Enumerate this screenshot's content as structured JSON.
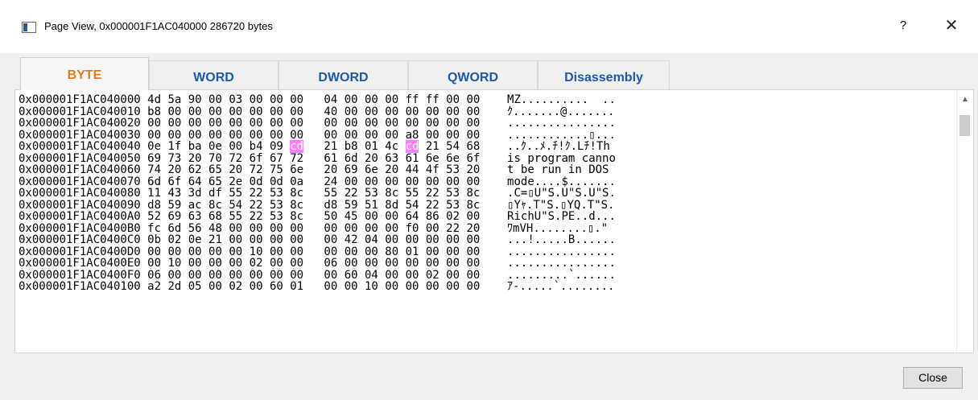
{
  "window": {
    "title": "Page View, 0x000001F1AC040000 286720 bytes",
    "help_label": "?",
    "close_glyph": "✕"
  },
  "tabs": [
    {
      "label": "BYTE",
      "active": true
    },
    {
      "label": "WORD",
      "active": false
    },
    {
      "label": "DWORD",
      "active": false
    },
    {
      "label": "QWORD",
      "active": false
    },
    {
      "label": "Disassembly",
      "active": false
    }
  ],
  "hex_rows": [
    {
      "addr": "0x000001F1AC040000",
      "b1": [
        "4d",
        "5a",
        "90",
        "00",
        "03",
        "00",
        "00",
        "00"
      ],
      "b2": [
        "04",
        "00",
        "00",
        "00",
        "ff",
        "ff",
        "00",
        "00"
      ],
      "ascii": "MZ..........  .."
    },
    {
      "addr": "0x000001F1AC040010",
      "b1": [
        "b8",
        "00",
        "00",
        "00",
        "00",
        "00",
        "00",
        "00"
      ],
      "b2": [
        "40",
        "00",
        "00",
        "00",
        "00",
        "00",
        "00",
        "00"
      ],
      "ascii": "ｸ.......@......."
    },
    {
      "addr": "0x000001F1AC040020",
      "b1": [
        "00",
        "00",
        "00",
        "00",
        "00",
        "00",
        "00",
        "00"
      ],
      "b2": [
        "00",
        "00",
        "00",
        "00",
        "00",
        "00",
        "00",
        "00"
      ],
      "ascii": "................"
    },
    {
      "addr": "0x000001F1AC040030",
      "b1": [
        "00",
        "00",
        "00",
        "00",
        "00",
        "00",
        "00",
        "00"
      ],
      "b2": [
        "00",
        "00",
        "00",
        "00",
        "a8",
        "00",
        "00",
        "00"
      ],
      "ascii": "............▯..."
    },
    {
      "addr": "0x000001F1AC040040",
      "b1": [
        "0e",
        "1f",
        "ba",
        "0e",
        "00",
        "b4",
        "09",
        "cd"
      ],
      "b2": [
        "21",
        "b8",
        "01",
        "4c",
        "cd",
        "21",
        "54",
        "68"
      ],
      "ascii": "..ｸ..ﾒ.ﾁ!ｸ.Lﾁ!Th"
    },
    {
      "addr": "0x000001F1AC040050",
      "b1": [
        "69",
        "73",
        "20",
        "70",
        "72",
        "6f",
        "67",
        "72"
      ],
      "b2": [
        "61",
        "6d",
        "20",
        "63",
        "61",
        "6e",
        "6e",
        "6f"
      ],
      "ascii": "is program canno"
    },
    {
      "addr": "0x000001F1AC040060",
      "b1": [
        "74",
        "20",
        "62",
        "65",
        "20",
        "72",
        "75",
        "6e"
      ],
      "b2": [
        "20",
        "69",
        "6e",
        "20",
        "44",
        "4f",
        "53",
        "20"
      ],
      "ascii": "t be run in DOS "
    },
    {
      "addr": "0x000001F1AC040070",
      "b1": [
        "6d",
        "6f",
        "64",
        "65",
        "2e",
        "0d",
        "0d",
        "0a"
      ],
      "b2": [
        "24",
        "00",
        "00",
        "00",
        "00",
        "00",
        "00",
        "00"
      ],
      "ascii": "mode....$......."
    },
    {
      "addr": "0x000001F1AC040080",
      "b1": [
        "11",
        "43",
        "3d",
        "df",
        "55",
        "22",
        "53",
        "8c"
      ],
      "b2": [
        "55",
        "22",
        "53",
        "8c",
        "55",
        "22",
        "53",
        "8c"
      ],
      "ascii": ".C=▯U\"S.U\"S.U\"S."
    },
    {
      "addr": "0x000001F1AC040090",
      "b1": [
        "d8",
        "59",
        "ac",
        "8c",
        "54",
        "22",
        "53",
        "8c"
      ],
      "b2": [
        "d8",
        "59",
        "51",
        "8d",
        "54",
        "22",
        "53",
        "8c"
      ],
      "ascii": "▯Yｬ.T\"S.▯YQ.T\"S."
    },
    {
      "addr": "0x000001F1AC0400A0",
      "b1": [
        "52",
        "69",
        "63",
        "68",
        "55",
        "22",
        "53",
        "8c"
      ],
      "b2": [
        "50",
        "45",
        "00",
        "00",
        "64",
        "86",
        "02",
        "00"
      ],
      "ascii": "RichU\"S.PE..d..."
    },
    {
      "addr": "0x000001F1AC0400B0",
      "b1": [
        "fc",
        "6d",
        "56",
        "48",
        "00",
        "00",
        "00",
        "00"
      ],
      "b2": [
        "00",
        "00",
        "00",
        "00",
        "f0",
        "00",
        "22",
        "20"
      ],
      "ascii": "ﾜmVH........▯.\" "
    },
    {
      "addr": "0x000001F1AC0400C0",
      "b1": [
        "0b",
        "02",
        "0e",
        "21",
        "00",
        "00",
        "00",
        "00"
      ],
      "b2": [
        "00",
        "42",
        "04",
        "00",
        "00",
        "00",
        "00",
        "00"
      ],
      "ascii": "...!.....B......"
    },
    {
      "addr": "0x000001F1AC0400D0",
      "b1": [
        "00",
        "00",
        "00",
        "00",
        "00",
        "10",
        "00",
        "00"
      ],
      "b2": [
        "00",
        "00",
        "00",
        "80",
        "01",
        "00",
        "00",
        "00"
      ],
      "ascii": "................"
    },
    {
      "addr": "0x000001F1AC0400E0",
      "b1": [
        "00",
        "10",
        "00",
        "00",
        "00",
        "02",
        "00",
        "00"
      ],
      "b2": [
        "06",
        "00",
        "00",
        "00",
        "00",
        "00",
        "00",
        "00"
      ],
      "ascii": "................"
    },
    {
      "addr": "0x000001F1AC0400F0",
      "b1": [
        "06",
        "00",
        "00",
        "00",
        "00",
        "00",
        "00",
        "00"
      ],
      "b2": [
        "00",
        "60",
        "04",
        "00",
        "00",
        "02",
        "00",
        "00"
      ],
      "ascii": ".........`......"
    },
    {
      "addr": "0x000001F1AC040100",
      "b1": [
        "a2",
        "2d",
        "05",
        "00",
        "02",
        "00",
        "60",
        "01"
      ],
      "b2": [
        "00",
        "00",
        "10",
        "00",
        "00",
        "00",
        "00",
        "00"
      ],
      "ascii": "ｱ-.....`........"
    }
  ],
  "highlight": {
    "color": "#ff80ff",
    "value": "cd"
  },
  "colors": {
    "active_tab": "#e07b1e",
    "inactive_tab": "#1c5aa6"
  },
  "buttons": {
    "close_label": "Close"
  }
}
